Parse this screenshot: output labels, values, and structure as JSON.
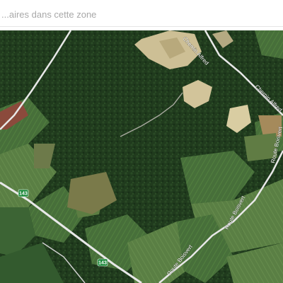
{
  "search": {
    "placeholder": "...aires dans cette zone"
  },
  "map": {
    "roads": {
      "chemin_alfred_upper": "Chemin Alfred",
      "chemin_alfred_right": "Chemin Alfred",
      "route_boisvert_right": "Route Boisvert",
      "route_boisvert_mid": "Route Boisvert",
      "route_boisvert_bottom": "Route Boisvert"
    },
    "route_shields": {
      "top": "143",
      "bottom": "143"
    },
    "colors": {
      "forest": "#1f3a1c",
      "field": "#3f6a35",
      "clearing": "#cdbf95",
      "road": "#e8e8e8",
      "shield": "#1e8a3c"
    }
  }
}
